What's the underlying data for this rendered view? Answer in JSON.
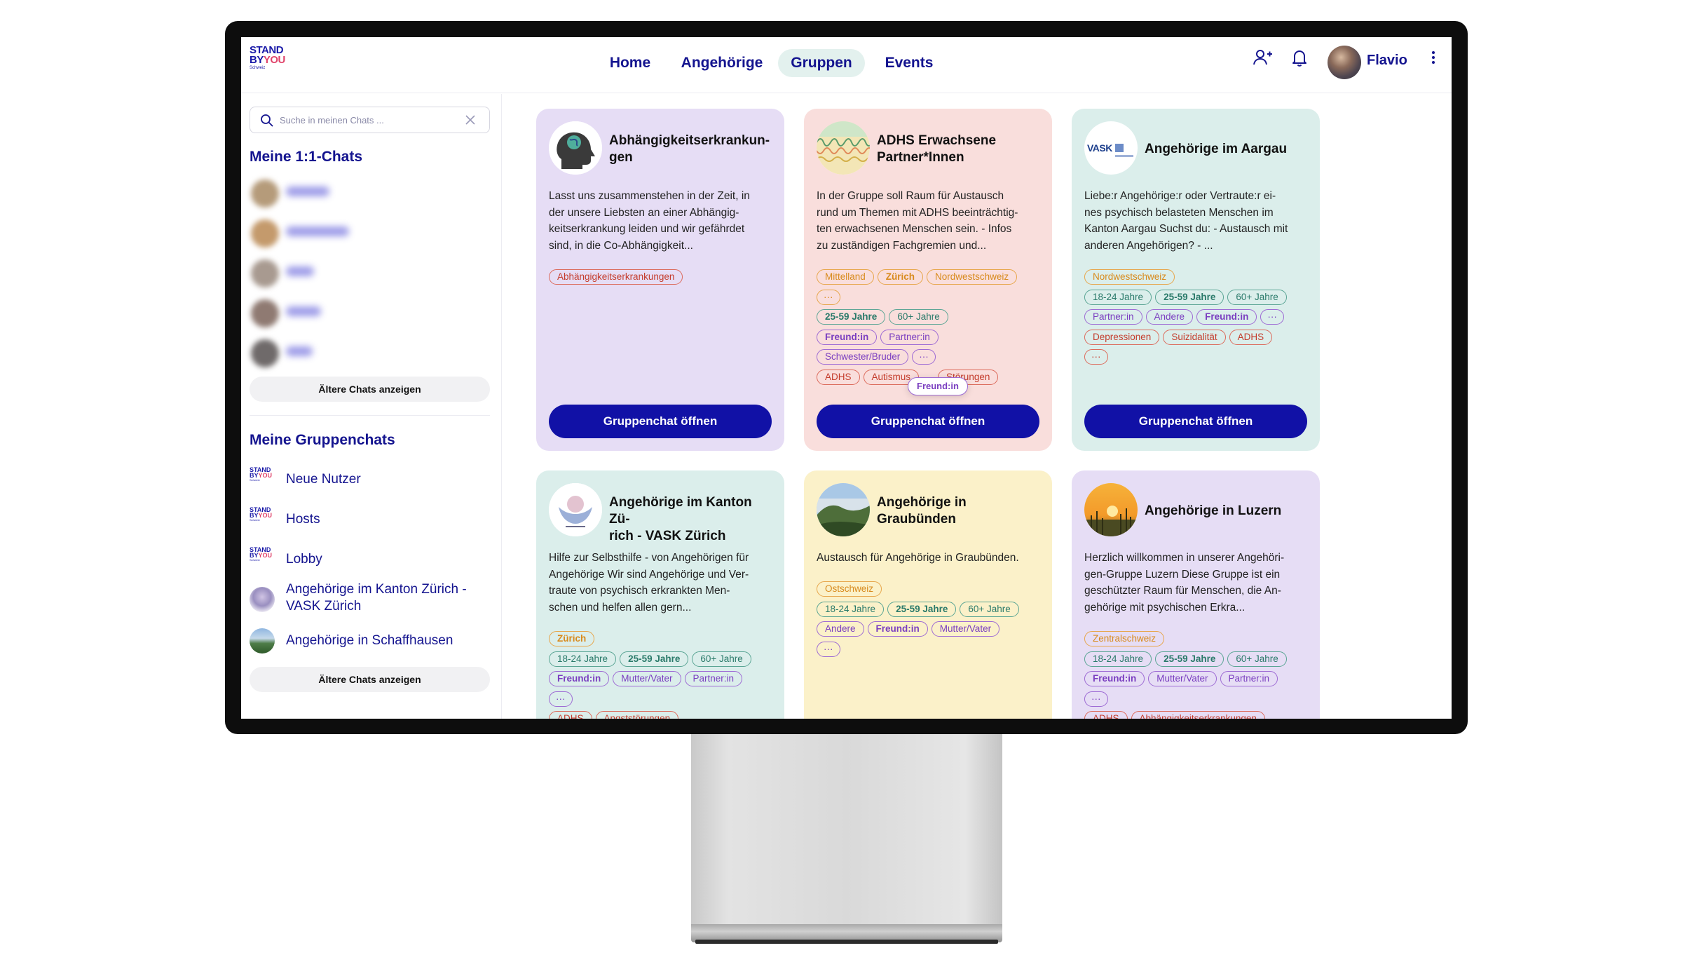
{
  "brand": {
    "line1": "STAND",
    "line2a": "BY",
    "line2b": "YOU",
    "line3": "Schweiz"
  },
  "nav": [
    {
      "label": "Home"
    },
    {
      "label": "Angehörige"
    },
    {
      "label": "Gruppen"
    },
    {
      "label": "Events"
    }
  ],
  "user": {
    "name": "Flavio"
  },
  "icons": [
    "add-person-icon",
    "bell-icon",
    "more-vertical-icon",
    "search-icon",
    "close-icon"
  ],
  "colors": {
    "primary": "#14148f",
    "button": "#1111a6",
    "active_nav_bg": "#e3f1ee",
    "accent_red": "#e0436a"
  },
  "sidebar": {
    "search_placeholder": "Suche in meinen Chats ...",
    "chats_title": "Meine 1:1-Chats",
    "older_chats_label": "Ältere Chats anzeigen",
    "groups_title": "Meine Gruppenchats",
    "groups": [
      {
        "name": "Neue Nutzer"
      },
      {
        "name": "Hosts"
      },
      {
        "name": "Lobby"
      },
      {
        "name_line1": "Angehörige im Kanton Zürich -",
        "name_line2": "VASK Zürich"
      },
      {
        "name": "Angehörige in Schaffhausen"
      }
    ],
    "older_groups_label": "Ältere Chats anzeigen"
  },
  "cards": [
    {
      "title_line1": "Abhängigkeitserkrankun-",
      "title_line2": "gen",
      "desc": [
        "Lasst uns zusammenstehen in der Zeit, in",
        "der unsere Liebsten an einer Abhängig-",
        "keitserkrankung leiden und wir gefährdet",
        "sind, in die Co-Abhängigkeit..."
      ],
      "tags": [
        [
          "Abhängigkeitserkrankungen"
        ]
      ],
      "button": "Gruppenchat öffnen"
    },
    {
      "title_line1": "ADHS Erwachsene",
      "title_line2": "Partner*Innen",
      "desc": [
        "In der Gruppe soll Raum für Austausch",
        "rund um Themen mit ADHS beeinträchtig-",
        "ten erwachsenen Menschen sein. - Infos",
        "zu zuständigen Fachgremien und..."
      ],
      "tags": [
        [
          "Mittelland",
          "Zürich",
          "Nordwestschweiz"
        ],
        [
          "···"
        ],
        [
          "25-59 Jahre",
          "60+ Jahre"
        ],
        [
          "Freund:in",
          "Partner:in"
        ],
        [
          "Schwester/Bruder",
          "···"
        ],
        [
          "ADHS",
          "Autismus",
          "Störungen"
        ]
      ],
      "tooltip": "Freund:in",
      "button": "Gruppenchat öffnen"
    },
    {
      "title": "Angehörige im Aargau",
      "desc": [
        "Liebe:r Angehörige:r oder Vertraute:r ei-",
        "nes psychisch belasteten Menschen im",
        "Kanton Aargau Suchst du: - Austausch mit",
        "anderen Angehörigen? - ..."
      ],
      "tags": [
        [
          "Nordwestschweiz"
        ],
        [
          "18-24 Jahre",
          "25-59 Jahre",
          "60+ Jahre"
        ],
        [
          "Partner:in",
          "Andere",
          "Freund:in",
          "···"
        ],
        [
          "Depressionen",
          "Suizidalität",
          "ADHS"
        ],
        [
          "···"
        ]
      ],
      "logo_text": "VASK",
      "button": "Gruppenchat öffnen"
    },
    {
      "title_line1": "Angehörige im Kanton Zü-",
      "title_line2": "rich - VASK Zürich",
      "desc": [
        "Hilfe zur Selbsthilfe - von Angehörigen für",
        "Angehörige Wir sind Angehörige und Ver-",
        "traute von psychisch erkrankten Men-",
        "schen und helfen allen gern..."
      ],
      "tags": [
        [
          "Zürich"
        ],
        [
          "18-24 Jahre",
          "25-59 Jahre",
          "60+ Jahre"
        ],
        [
          "Freund:in",
          "Mutter/Vater",
          "Partner:in"
        ],
        [
          "···"
        ],
        [
          "ADHS",
          "Angststörungen"
        ]
      ]
    },
    {
      "title_line1": "Angehörige in",
      "title_line2": "Graubünden",
      "desc": [
        "Austausch für Angehörige in Graubünden."
      ],
      "tags": [
        [
          "Ostschweiz"
        ],
        [
          "18-24 Jahre",
          "25-59 Jahre",
          "60+ Jahre"
        ],
        [
          "Andere",
          "Freund:in",
          "Mutter/Vater"
        ],
        [
          "···"
        ]
      ]
    },
    {
      "title": "Angehörige in Luzern",
      "desc": [
        "Herzlich willkommen in unserer Angehöri-",
        "gen-Gruppe Luzern Diese Gruppe ist ein",
        "geschützter Raum für Menschen, die An-",
        "gehörige mit psychischen Erkra..."
      ],
      "tags": [
        [
          "Zentralschweiz"
        ],
        [
          "18-24 Jahre",
          "25-59 Jahre",
          "60+ Jahre"
        ],
        [
          "Freund:in",
          "Mutter/Vater",
          "Partner:in"
        ],
        [
          "···"
        ],
        [
          "ADHS",
          "Abhängigkeitserkrankungen"
        ]
      ]
    }
  ]
}
